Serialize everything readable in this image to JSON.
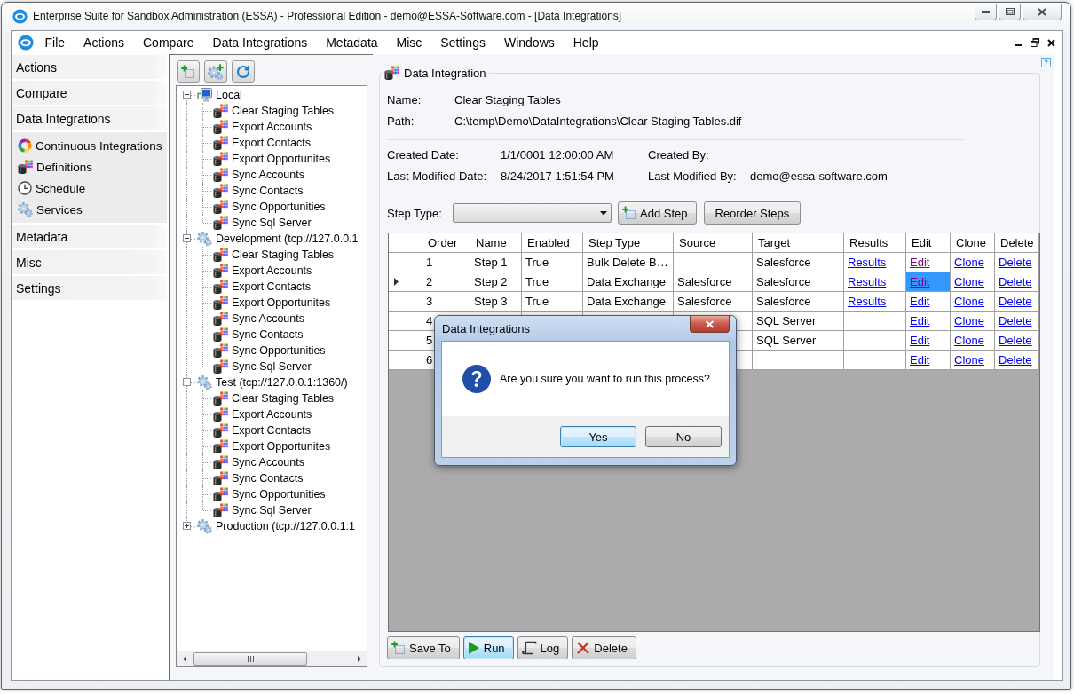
{
  "window": {
    "title": "Enterprise Suite for Sandbox Administration (ESSA) - Professional Edition - demo@ESSA-Software.com - [Data Integrations]"
  },
  "menu": [
    "File",
    "Actions",
    "Compare",
    "Data Integrations",
    "Metadata",
    "Misc",
    "Settings",
    "Windows",
    "Help"
  ],
  "sidebar": [
    {
      "label": "Actions"
    },
    {
      "label": "Compare"
    },
    {
      "label": "Data Integrations",
      "children": [
        {
          "label": "Continuous Integrations",
          "kind": "ring"
        },
        {
          "label": "Definitions",
          "kind": "definitions"
        },
        {
          "label": "Schedule",
          "kind": "clock"
        },
        {
          "label": "Services",
          "kind": "gears"
        }
      ]
    },
    {
      "label": "Metadata"
    },
    {
      "label": "Misc"
    },
    {
      "label": "Settings"
    }
  ],
  "tree": [
    {
      "label": "Local",
      "kind": "computer",
      "expanded": true,
      "children": [
        {
          "label": "Clear Staging Tables",
          "kind": "integration"
        },
        {
          "label": "Export Accounts",
          "kind": "integration"
        },
        {
          "label": "Export Contacts",
          "kind": "integration"
        },
        {
          "label": "Export Opportunites",
          "kind": "integration"
        },
        {
          "label": "Sync Accounts",
          "kind": "integration"
        },
        {
          "label": "Sync Contacts",
          "kind": "integration"
        },
        {
          "label": "Sync Opportunities",
          "kind": "integration"
        },
        {
          "label": "Sync Sql Server",
          "kind": "integration"
        }
      ]
    },
    {
      "label": "Development (tcp://127.0.0.1",
      "kind": "server",
      "expanded": true,
      "children": [
        {
          "label": "Clear Staging Tables",
          "kind": "integration"
        },
        {
          "label": "Export Accounts",
          "kind": "integration"
        },
        {
          "label": "Export Contacts",
          "kind": "integration"
        },
        {
          "label": "Export Opportunites",
          "kind": "integration"
        },
        {
          "label": "Sync Accounts",
          "kind": "integration"
        },
        {
          "label": "Sync Contacts",
          "kind": "integration"
        },
        {
          "label": "Sync Opportunities",
          "kind": "integration"
        },
        {
          "label": "Sync Sql Server",
          "kind": "integration"
        }
      ]
    },
    {
      "label": "Test (tcp://127.0.0.1:1360/)",
      "kind": "server",
      "expanded": true,
      "children": [
        {
          "label": "Clear Staging Tables",
          "kind": "integration"
        },
        {
          "label": "Export Accounts",
          "kind": "integration"
        },
        {
          "label": "Export Contacts",
          "kind": "integration"
        },
        {
          "label": "Export Opportunites",
          "kind": "integration"
        },
        {
          "label": "Sync Accounts",
          "kind": "integration"
        },
        {
          "label": "Sync Contacts",
          "kind": "integration"
        },
        {
          "label": "Sync Opportunities",
          "kind": "integration"
        },
        {
          "label": "Sync Sql Server",
          "kind": "integration"
        }
      ]
    },
    {
      "label": "Production (tcp://127.0.0.1:1",
      "kind": "server",
      "expanded": false
    }
  ],
  "detail": {
    "title": "Data Integration",
    "fields": [
      {
        "label": "Name:",
        "value": "Clear Staging Tables"
      },
      {
        "label": "Path:",
        "value": "C:\\temp\\Demo\\DataIntegrations\\Clear Staging Tables.dif"
      }
    ],
    "dates": [
      {
        "label": "Created Date:",
        "value": "1/1/0001 12:00:00 AM",
        "by_label": "Created By:"
      },
      {
        "label": "Last Modified Date:",
        "value": "8/24/2017 1:51:54 PM",
        "by_label": "Last Modified By:",
        "by_value": "demo@essa-software.com"
      }
    ],
    "step_type": {
      "label": "Step Type:"
    },
    "step_buttons": [
      {
        "label": "Add Step",
        "kind": "add"
      },
      {
        "label": "Reorder Steps",
        "kind": "plain"
      }
    ]
  },
  "grid": {
    "columns": [
      "Order",
      "Name",
      "Enabled",
      "Step Type",
      "Source",
      "Target",
      "Results",
      "Edit",
      "Clone",
      "Delete"
    ],
    "rows": [
      {
        "selected": false,
        "order": "1",
        "name": "Step 1",
        "enabled": "True",
        "step_type": "Bulk Delete B…",
        "target": "Salesforce",
        "results": {
          "text": "Results",
          "visited": false
        },
        "edit": {
          "text": "Edit",
          "visited": true,
          "selected": false
        },
        "clone": {
          "text": "Clone",
          "visited": false
        },
        "delete": {
          "text": "Delete",
          "visited": false
        }
      },
      {
        "selected": true,
        "order": "2",
        "name": "Step 2",
        "enabled": "True",
        "step_type": "Data Exchange",
        "source": "Salesforce",
        "target": "Salesforce",
        "results": {
          "text": "Results",
          "visited": false
        },
        "edit": {
          "text": "Edit",
          "visited": true,
          "selected": true
        },
        "clone": {
          "text": "Clone",
          "visited": false
        },
        "delete": {
          "text": "Delete",
          "visited": false
        }
      },
      {
        "selected": false,
        "order": "3",
        "name": "Step 3",
        "enabled": "True",
        "step_type": "Data Exchange",
        "source": "Salesforce",
        "target": "Salesforce",
        "results": {
          "text": "Results",
          "visited": false
        },
        "edit": {
          "text": "Edit",
          "visited": false,
          "selected": false
        },
        "clone": {
          "text": "Clone",
          "visited": false
        },
        "delete": {
          "text": "Delete",
          "visited": false
        }
      },
      {
        "selected": false,
        "order": "4",
        "target": "SQL Server",
        "edit": {
          "text": "Edit",
          "visited": false,
          "selected": false
        },
        "clone": {
          "text": "Clone",
          "visited": false
        },
        "delete": {
          "text": "Delete",
          "visited": false
        }
      },
      {
        "selected": false,
        "order": "5",
        "target": "SQL Server",
        "edit": {
          "text": "Edit",
          "visited": false,
          "selected": false
        },
        "clone": {
          "text": "Clone",
          "visited": false
        },
        "delete": {
          "text": "Delete",
          "visited": false
        }
      },
      {
        "selected": false,
        "order": "6",
        "edit": {
          "text": "Edit",
          "visited": false,
          "selected": false
        },
        "clone": {
          "text": "Clone",
          "visited": false
        },
        "delete": {
          "text": "Delete",
          "visited": false
        }
      }
    ]
  },
  "actions": [
    {
      "label": "Save To",
      "kind": "save",
      "focused": false
    },
    {
      "label": "Run",
      "kind": "run",
      "focused": true
    },
    {
      "label": "Log",
      "kind": "log",
      "focused": false
    },
    {
      "label": "Delete",
      "kind": "delete",
      "focused": false
    }
  ],
  "dialog": {
    "title": "Data Integrations",
    "message": "Are you sure you want to run this process?",
    "buttons": [
      {
        "label": "Yes",
        "focused": true
      },
      {
        "label": "No",
        "focused": false
      }
    ]
  }
}
